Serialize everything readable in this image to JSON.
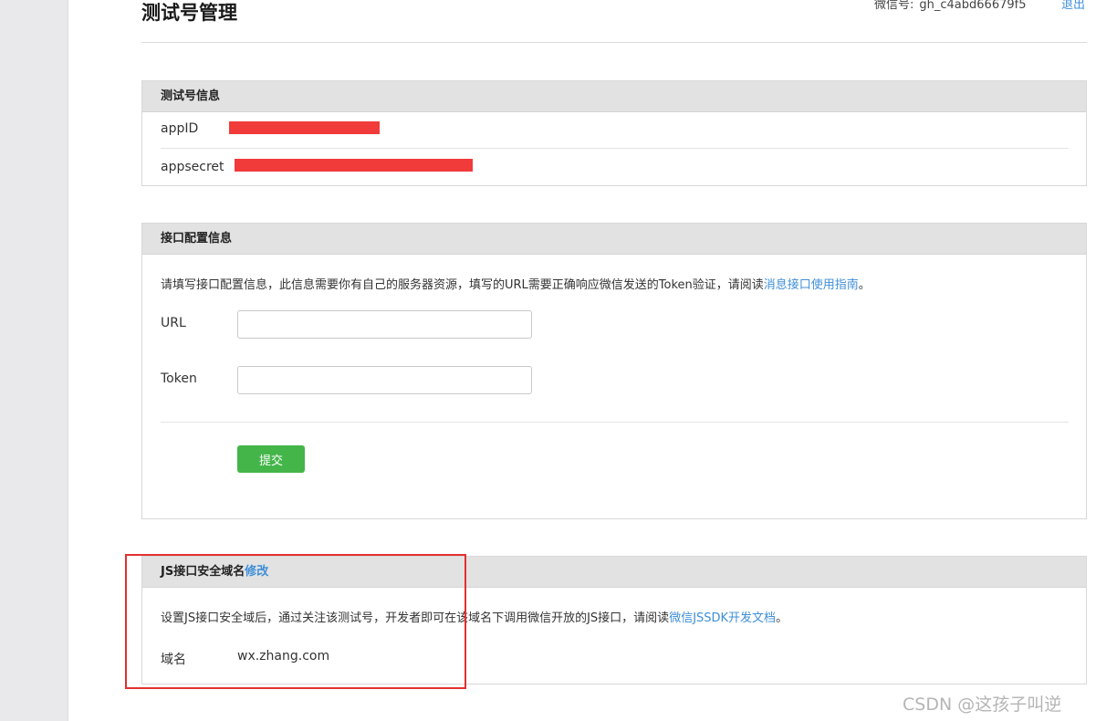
{
  "header": {
    "title": "测试号管理",
    "account_label": "微信号:",
    "account_id": "gh_c4abd66679f5",
    "logout_label": "退出"
  },
  "test_account_panel": {
    "title": "测试号信息",
    "rows": [
      {
        "label": "appID",
        "value_redacted": true
      },
      {
        "label": "appsecret",
        "value_redacted": true
      }
    ]
  },
  "interface_config_panel": {
    "title": "接口配置信息",
    "description": "请填写接口配置信息，此信息需要你有自己的服务器资源，填写的URL需要正确响应微信发送的Token验证，请阅读",
    "description_link": "消息接口使用指南",
    "description_end": "。",
    "url_label": "URL",
    "url_value": "",
    "token_label": "Token",
    "token_value": "",
    "submit_label": "提交"
  },
  "js_domain_panel": {
    "title": "JS接口安全域名",
    "edit_link": "修改",
    "description": "设置JS接口安全域后，通过关注该测试号，开发者即可在该域名下调用微信开放的JS接口，请阅读",
    "description_link": "微信JSSDK开发文档",
    "description_end": "。",
    "domain_label": "域名",
    "domain_value": "wx.zhang.com"
  },
  "watermark": "CSDN @这孩子叫逆",
  "colors": {
    "link": "#3f8fd8",
    "submit": "#44b549",
    "redaction": "#f13a3a",
    "highlight_box": "#e2312f",
    "panel_header": "#e2e2e2"
  }
}
